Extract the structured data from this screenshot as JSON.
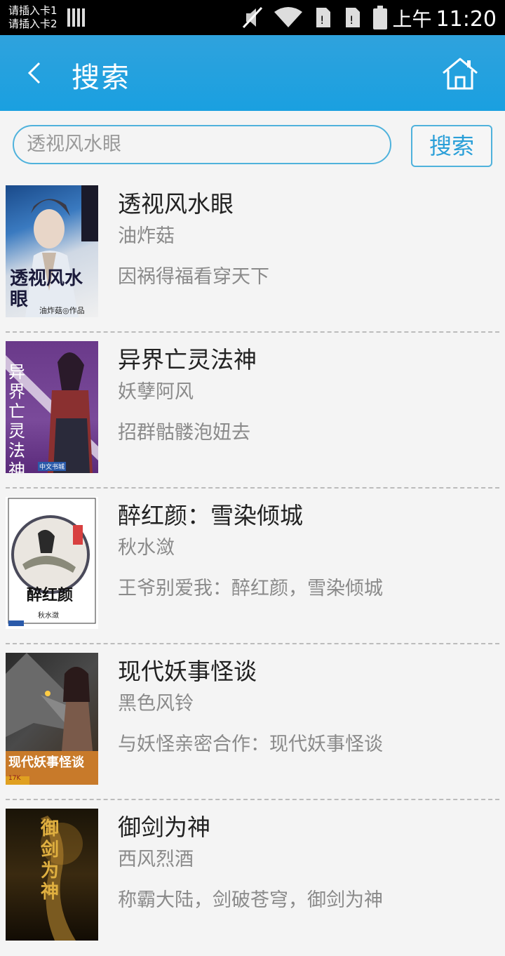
{
  "status_bar": {
    "sim1": "请插入卡1",
    "sim2": "请插入卡2",
    "ampm": "上午",
    "time": "11:20"
  },
  "header": {
    "title": "搜索"
  },
  "search": {
    "value": "透视风水眼",
    "button_label": "搜索"
  },
  "books": [
    {
      "title": "透视风水眼",
      "author": "油炸菇",
      "desc": "因祸得福看穿天下",
      "cover_text": "透视风水眼",
      "cover_sub": "油炸菇◎作品"
    },
    {
      "title": "异界亡灵法神",
      "author": "妖孽阿风",
      "desc": "招群骷髅泡妞去",
      "cover_text": "异界亡灵法神",
      "cover_sub": "中文书城"
    },
    {
      "title": "醉红颜：雪染倾城",
      "author": "秋水潋",
      "desc": "王爷别爱我：醉红颜，雪染倾城",
      "cover_text": "醉红颜",
      "cover_sub": "秋水潋"
    },
    {
      "title": "现代妖事怪谈",
      "author": "黑色风铃",
      "desc": "与妖怪亲密合作：现代妖事怪谈",
      "cover_text": "现代妖事怪谈",
      "cover_sub": "17K"
    },
    {
      "title": "御剑为神",
      "author": "西风烈酒",
      "desc": "称霸大陆，剑破苍穹，御剑为神",
      "cover_text": "御剑为神",
      "cover_sub": ""
    }
  ]
}
